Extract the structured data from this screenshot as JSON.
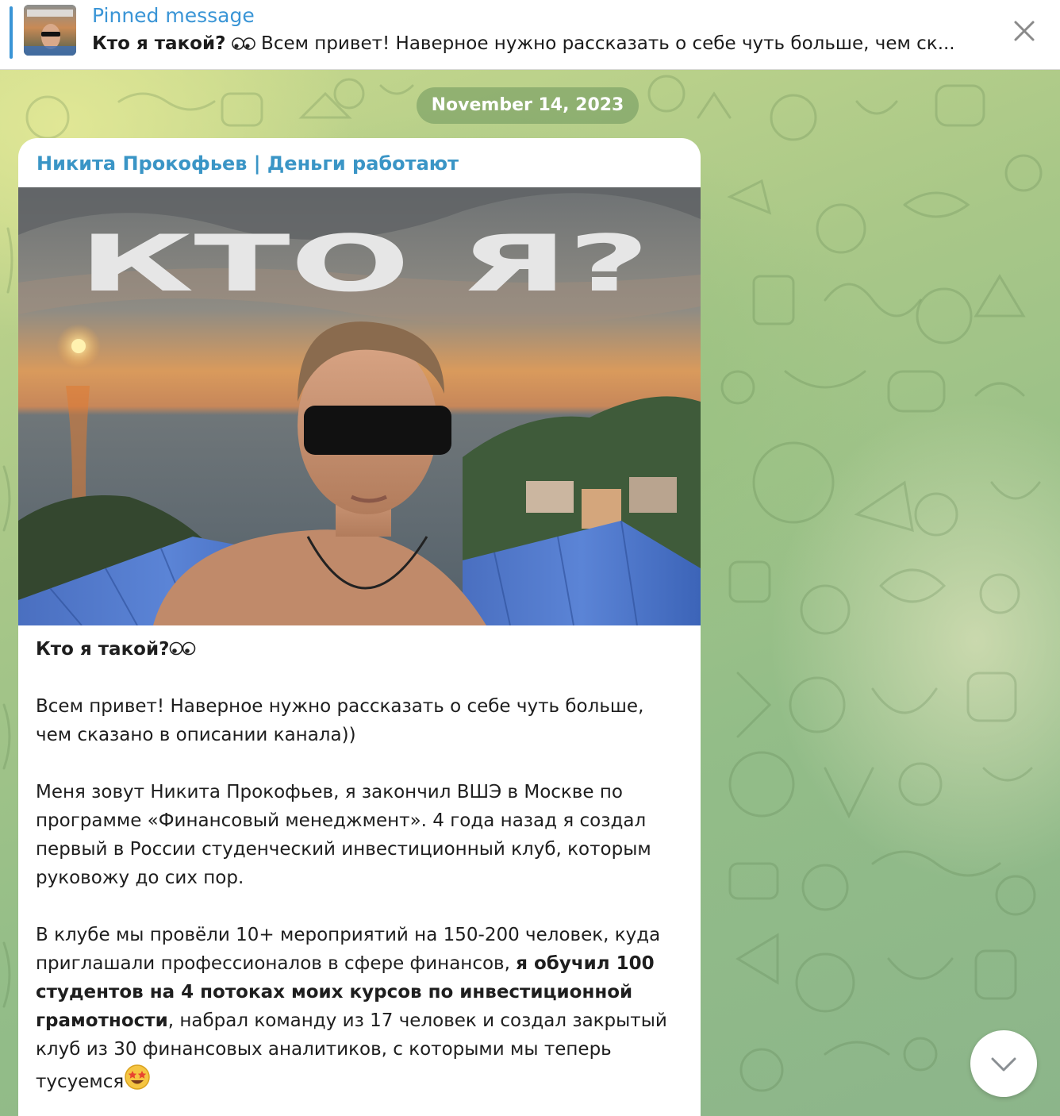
{
  "pinned": {
    "title": "Pinned message",
    "preview_bold": "Кто я такой?",
    "preview_text": " Всем привет! Наверное нужно рассказать о себе чуть больше, чем ск..."
  },
  "chat": {
    "date_label": "November 14, 2023"
  },
  "message": {
    "sender": "Никита Прокофьев | Деньги работают",
    "image_caption_text": "КТО Я?",
    "post_title": "Кто я такой?",
    "paragraph_1": "Всем привет! Наверное нужно рассказать о себе чуть больше, чем сказано в описании канала))",
    "paragraph_2": "Меня зовут Никита Прокофьев, я закончил ВШЭ в Москве по программе «Финансовый менеджмент». 4 года назад я создал первый в России студенческий инвестиционный клуб, которым руковожу до сих пор.",
    "paragraph_3_part_1": "В клубе мы провёли 10+ мероприятий на 150-200 человек, куда приглашали профессионалов в сфере финансов, ",
    "paragraph_3_bold": "я обучил 100 студентов на 4 потоках моих курсов по инвестиционной грамотности",
    "paragraph_3_part_2": ", набрал команду из 17 человек и создал закрытый клуб из 30 финансовых аналитиков, с которыми мы теперь тусуемся"
  },
  "colors": {
    "accent": "#3a95d6",
    "sender_color": "#3a95c6",
    "bubble_bg": "#ffffff"
  },
  "icons": {
    "close": "close-icon",
    "scroll_down": "chevron-down-icon",
    "title_emoji": "eyes-emoji-icon",
    "end_emoji": "star-struck-emoji-icon"
  }
}
